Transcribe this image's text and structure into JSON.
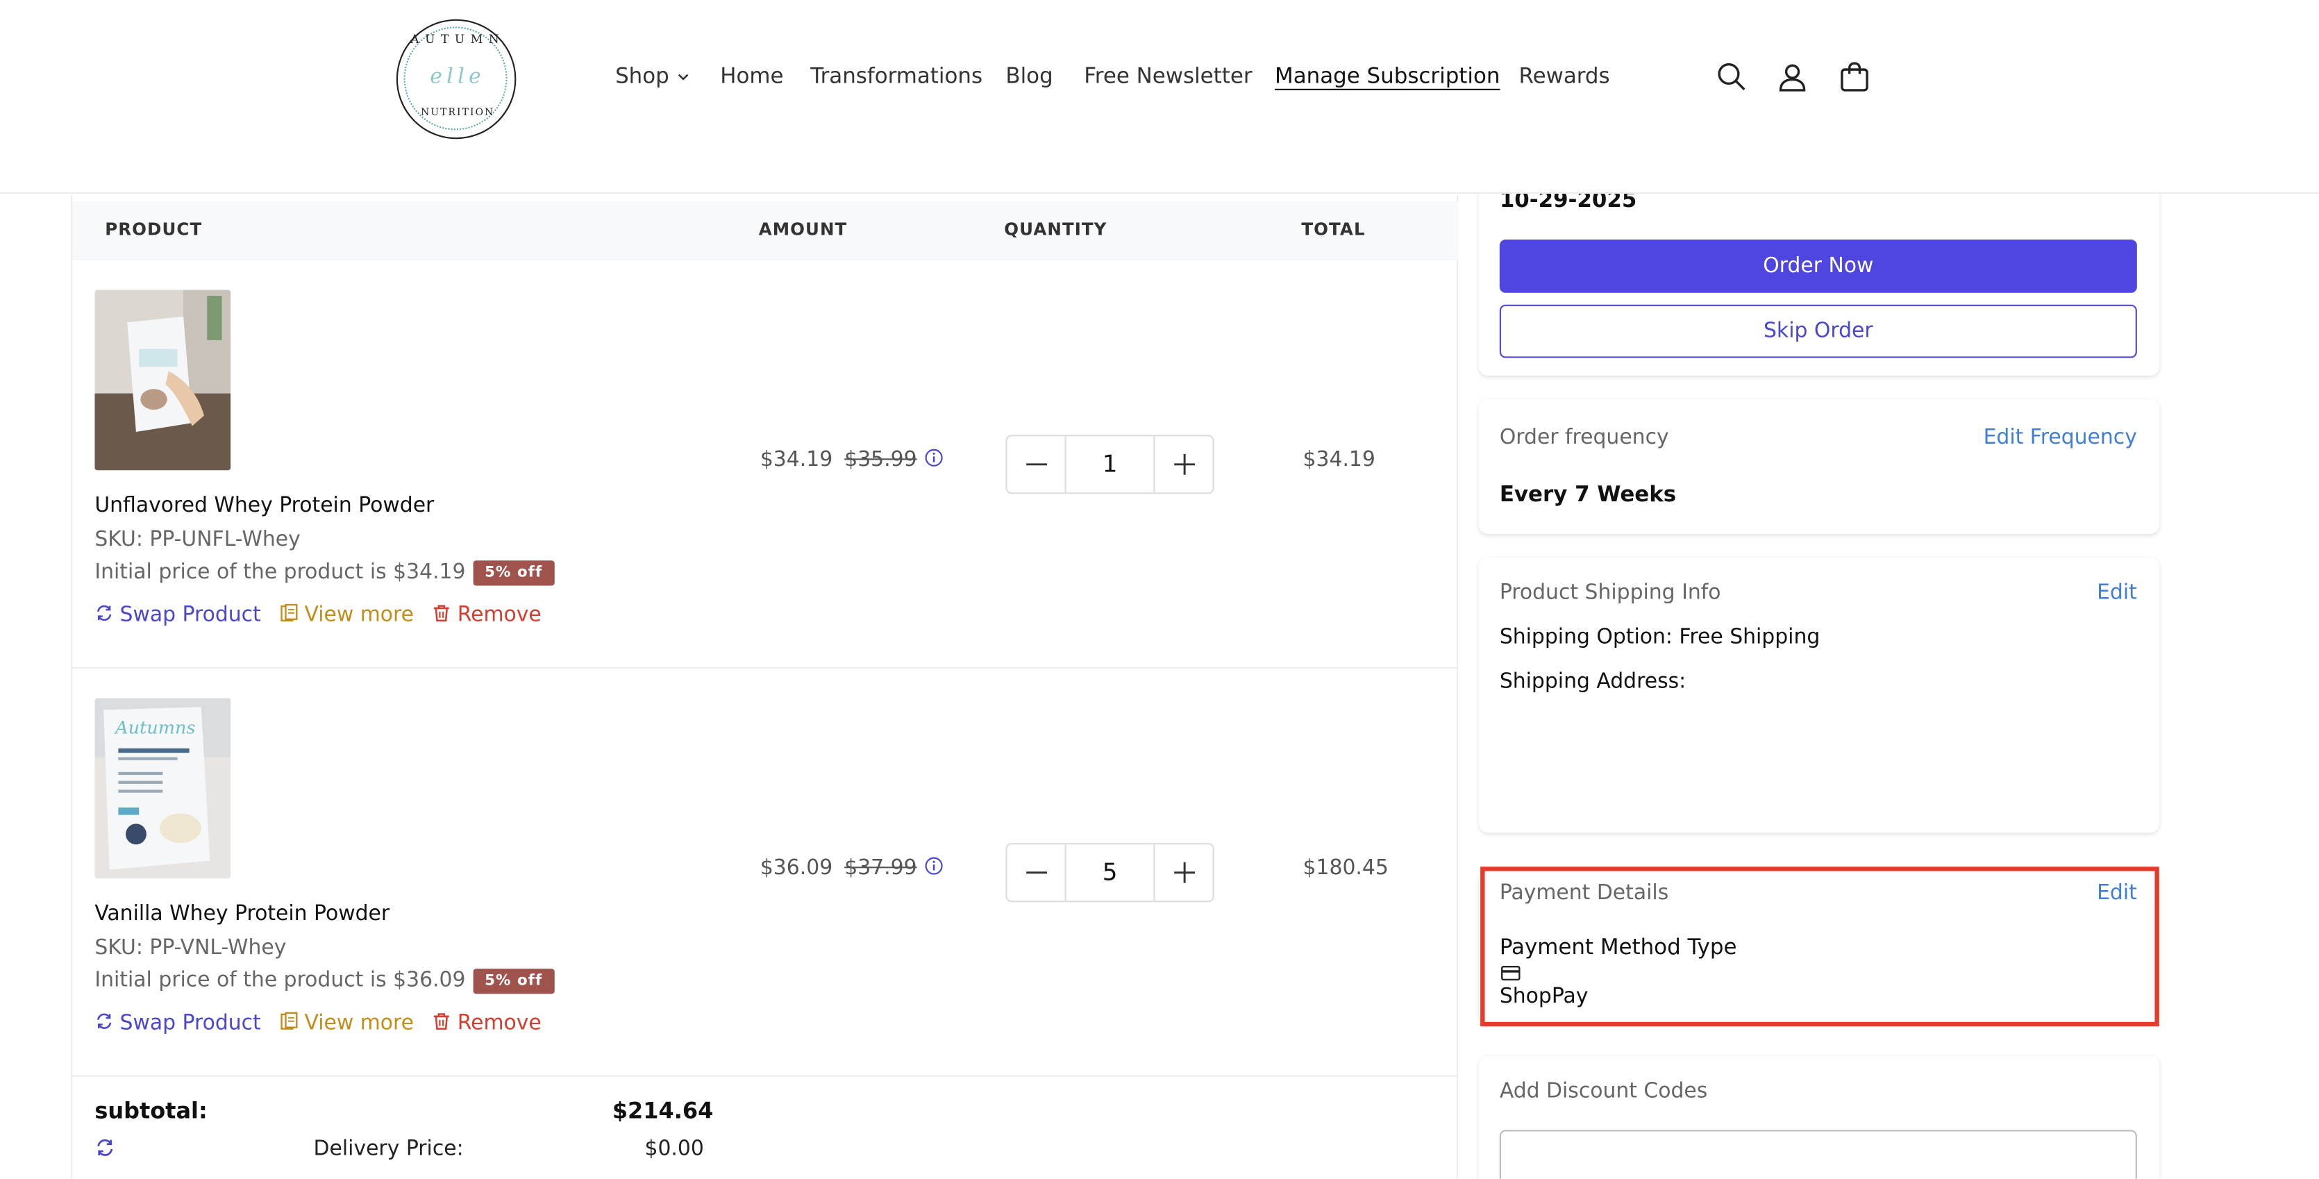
{
  "header": {
    "logo": {
      "top": "AUTUMN",
      "mid": "elle",
      "bottom": "NUTRITION"
    },
    "nav": [
      {
        "label": "Shop",
        "has_dropdown": true
      },
      {
        "label": "Home"
      },
      {
        "label": "Transformations"
      },
      {
        "label": "Blog"
      },
      {
        "label": "Free Newsletter"
      },
      {
        "label": "Manage Subscription",
        "active": true
      },
      {
        "label": "Rewards"
      }
    ],
    "icons": [
      "search-icon",
      "account-icon",
      "cart-icon"
    ]
  },
  "table": {
    "headers": {
      "product": "PRODUCT",
      "amount": "AMOUNT",
      "quantity": "QUANTITY",
      "total": "TOTAL"
    },
    "items": [
      {
        "name": "Unflavored Whey Protein Powder",
        "sku": "SKU: PP-UNFL-Whey",
        "initial_price_text": "Initial price of the product is $34.19",
        "badge": "5% off",
        "price": "$34.19",
        "old_price": "$35.99",
        "quantity": "1",
        "total": "$34.19",
        "actions": {
          "swap": "Swap Product",
          "view": "View more",
          "remove": "Remove"
        }
      },
      {
        "name": "Vanilla Whey Protein Powder",
        "sku": "SKU: PP-VNL-Whey",
        "initial_price_text": "Initial price of the product is $36.09",
        "badge": "5% off",
        "price": "$36.09",
        "old_price": "$37.99",
        "quantity": "5",
        "total": "$180.45",
        "actions": {
          "swap": "Swap Product",
          "view": "View more",
          "remove": "Remove"
        }
      }
    ]
  },
  "summary": {
    "subtotal_label": "subtotal:",
    "subtotal_value": "$214.64",
    "delivery_label": "Delivery Price:",
    "delivery_value": "$0.00"
  },
  "sidebar": {
    "next_order": {
      "date": "10-29-2025",
      "order_now": "Order Now",
      "skip_order": "Skip Order"
    },
    "frequency": {
      "title": "Order frequency",
      "edit": "Edit Frequency",
      "value": "Every 7 Weeks"
    },
    "shipping": {
      "title": "Product Shipping Info",
      "edit": "Edit",
      "option": "Shipping Option: Free Shipping",
      "address_label": "Shipping Address:"
    },
    "payment": {
      "title": "Payment Details",
      "edit": "Edit",
      "method_type_label": "Payment Method Type",
      "method": "ShopPay"
    },
    "discount": {
      "title": "Add Discount Codes",
      "placeholder": ""
    }
  },
  "colors": {
    "primary": "#4f46e0",
    "link": "#3f7fd6",
    "badge": "#a0524d",
    "swap": "#4b47cc",
    "view": "#c28e1a",
    "remove": "#d23f31",
    "highlight": "#e33b2c"
  }
}
